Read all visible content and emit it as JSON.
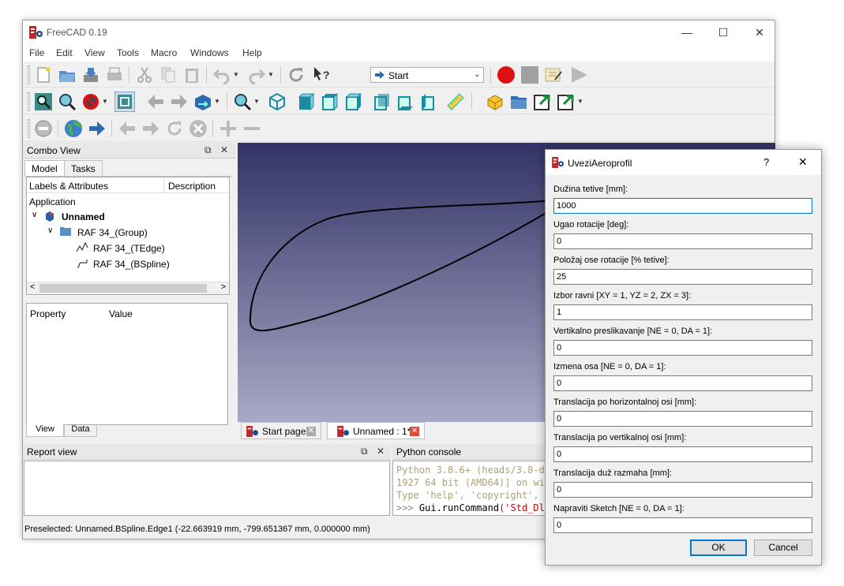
{
  "window": {
    "title": "FreeCAD 0.19"
  },
  "menu": [
    "File",
    "Edit",
    "View",
    "Tools",
    "Macro",
    "Windows",
    "Help"
  ],
  "toolbar": {
    "workbench": "Start"
  },
  "combo_view": {
    "title": "Combo View",
    "tabs": [
      "Model",
      "Tasks"
    ],
    "tree_headers": [
      "Labels & Attributes",
      "Description"
    ],
    "tree_root": "Application",
    "tree_items": [
      "Unnamed",
      "RAF 34_(Group)",
      "RAF 34_(TEdge)",
      "RAF 34_(BSpline)"
    ],
    "prop_headers": [
      "Property",
      "Value"
    ],
    "bottom_tabs": [
      "View",
      "Data"
    ]
  },
  "view_tabs": [
    "Start page",
    "Unnamed : 1*"
  ],
  "report_view": {
    "title": "Report view"
  },
  "python_console": {
    "title": "Python console",
    "lines": [
      "Python 3.8.6+ (heads/3.8-dirty:a",
      "1927 64 bit (AMD64)] on win32",
      "Type 'help', 'copyright', 'credits' o"
    ],
    "prompt": ">>> ",
    "cmd": "Gui.runCommand",
    "cmd_arg": "('Std_DlgM"
  },
  "status": "Preselected: Unnamed.BSpline.Edge1 (-22.663919 mm, -799.651367 mm, 0.000000 mm)",
  "dialog": {
    "title": "UveziAeroprofil",
    "help": "?",
    "fields": [
      {
        "label": "Dužina tetive [mm]:",
        "value": "1000"
      },
      {
        "label": "Ugao rotacije [deg]:",
        "value": "0"
      },
      {
        "label": "Položaj ose rotacije [% tetive]:",
        "value": "25"
      },
      {
        "label": "Izbor ravni [XY = 1, YZ = 2, ZX = 3]:",
        "value": "1"
      },
      {
        "label": "Vertikalno preslikavanje [NE = 0, DA = 1]:",
        "value": "0"
      },
      {
        "label": "Izmena osa [NE = 0, DA = 1]:",
        "value": "0"
      },
      {
        "label": "Translacija po horizontalnoj osi [mm]:",
        "value": "0"
      },
      {
        "label": "Translacija po vertikalnoj osi [mm]:",
        "value": "0"
      },
      {
        "label": "Translacija duž razmaha [mm]:",
        "value": "0"
      },
      {
        "label": "Napraviti Sketch [NE = 0, DA = 1]:",
        "value": "0"
      }
    ],
    "ok": "OK",
    "cancel": "Cancel"
  }
}
